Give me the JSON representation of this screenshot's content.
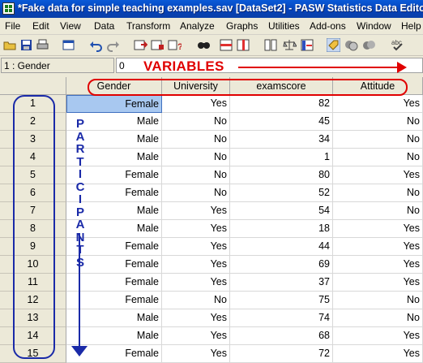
{
  "window": {
    "title": "*Fake data for simple teaching examples.sav [DataSet2] - PASW Statistics Data Editor"
  },
  "menu": [
    "File",
    "Edit",
    "View",
    "Data",
    "Transform",
    "Analyze",
    "Graphs",
    "Utilities",
    "Add-ons",
    "Window",
    "Help"
  ],
  "toolbar_icons": [
    "open-folder-icon",
    "save-icon",
    "print-icon",
    "dialog-recall-icon",
    "undo-icon",
    "redo-icon",
    "goto-case-icon",
    "goto-variable-icon",
    "variables-info-icon",
    "find-icon",
    "insert-cases-icon",
    "insert-variable-icon",
    "split-file-icon",
    "weight-cases-icon",
    "select-cases-icon",
    "value-labels-icon",
    "use-sets-icon",
    "show-all-variables-icon",
    "spell-check-icon"
  ],
  "cell_editor": {
    "reference": "1 : Gender",
    "value": "0"
  },
  "annotations": {
    "variables": "VARIABLES",
    "participants": "PARTICIPANTS"
  },
  "columns": [
    "Gender",
    "University",
    "examscore",
    "Attitude"
  ],
  "rows": [
    [
      "1",
      "Female",
      "Yes",
      "82",
      "Yes"
    ],
    [
      "2",
      "Male",
      "No",
      "45",
      "No"
    ],
    [
      "3",
      "Male",
      "No",
      "34",
      "No"
    ],
    [
      "4",
      "Male",
      "No",
      "1",
      "No"
    ],
    [
      "5",
      "Female",
      "No",
      "80",
      "Yes"
    ],
    [
      "6",
      "Female",
      "No",
      "52",
      "No"
    ],
    [
      "7",
      "Male",
      "Yes",
      "54",
      "No"
    ],
    [
      "8",
      "Male",
      "Yes",
      "18",
      "Yes"
    ],
    [
      "9",
      "Female",
      "Yes",
      "44",
      "Yes"
    ],
    [
      "10",
      "Female",
      "Yes",
      "69",
      "Yes"
    ],
    [
      "11",
      "Female",
      "Yes",
      "37",
      "Yes"
    ],
    [
      "12",
      "Female",
      "No",
      "75",
      "No"
    ],
    [
      "13",
      "Male",
      "Yes",
      "74",
      "No"
    ],
    [
      "14",
      "Male",
      "Yes",
      "68",
      "Yes"
    ],
    [
      "15",
      "Female",
      "Yes",
      "72",
      "Yes"
    ]
  ],
  "colors": {
    "annotation_red": "#e00000",
    "annotation_blue": "#1a2aa8",
    "selection": "#a8c8f0"
  }
}
